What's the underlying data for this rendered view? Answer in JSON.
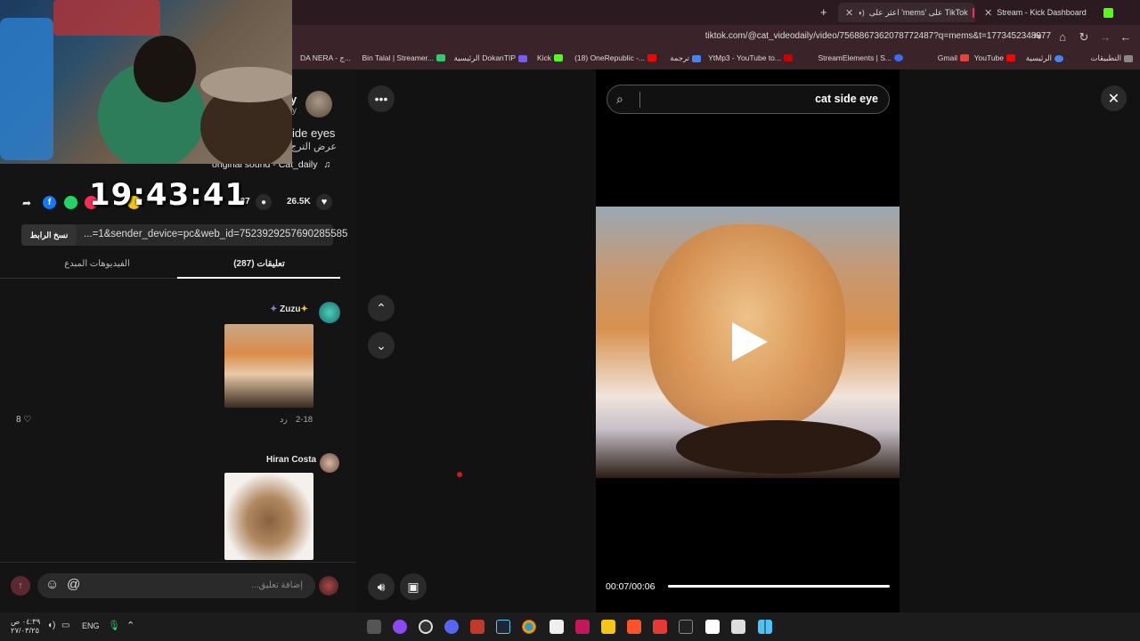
{
  "browser": {
    "tabs": [
      {
        "title": "Stream - Kick Dashboard",
        "color": "#53fc18"
      },
      {
        "title": "اعثر على 'mems' على TikTok",
        "color": "#fe2c55"
      }
    ],
    "new_tab_symbol": "+",
    "url": "tiktok.com/@cat_videodaily/video/7568867362078772487?q=mems&t=1773452348977",
    "bookmarks": [
      {
        "label": "التطبيقات",
        "color": "#888888"
      },
      {
        "label": "الرئيسية",
        "color": "#4285f4"
      },
      {
        "label": "YouTube",
        "color": "#ff0000"
      },
      {
        "label": "Gmail",
        "color": "#ea4335"
      },
      {
        "label": "StreamElements | S...",
        "color": "#3a6cf4"
      },
      {
        "label": "YtMp3 - YouTube to...",
        "color": "#cc0000"
      },
      {
        "label": "ترجمة",
        "color": "#4285f4"
      },
      {
        "label": "(18) OneRepublic -...",
        "color": "#ff0000"
      },
      {
        "label": "Kick",
        "color": "#53fc18"
      },
      {
        "label": "الرئيسية DokanTIP",
        "color": "#7a5af8"
      },
      {
        "label": "Bin Talal | Streamer...",
        "color": "#2ecc71"
      },
      {
        "label": "DA NERA - ج...",
        "color": "#e67e22"
      }
    ]
  },
  "overlay": {
    "clock": "19:43:41"
  },
  "video_info": {
    "author_fragment": "y",
    "author_fragment2": "y",
    "caption": "ide eyes",
    "see_translation": "عرض الترج",
    "sound": "original sound - Cat_daily",
    "likes": "26.5K",
    "comments_count": "287",
    "copy_link_label": "نسخ الرابط",
    "link_text": "...=1&sender_device=pc&web_id=7523929257690285585"
  },
  "tabs": {
    "comments": "تعليقات (287)",
    "creator_videos": "الفيديوهات المبدع"
  },
  "comments": [
    {
      "user": "Zuzu",
      "date": "2-18",
      "reply": "رد",
      "likes": "8"
    },
    {
      "user": "Hiran Costa"
    }
  ],
  "comment_input": {
    "placeholder": "إضافة تعليق..."
  },
  "search": {
    "query": "cat side eye"
  },
  "player": {
    "time": "00:07/00:06",
    "progress": 1.0
  },
  "taskbar": {
    "lang": "ENG",
    "time": "٠٤:٣٩ ص",
    "date": "٢٧/٠٣/٢٥"
  }
}
